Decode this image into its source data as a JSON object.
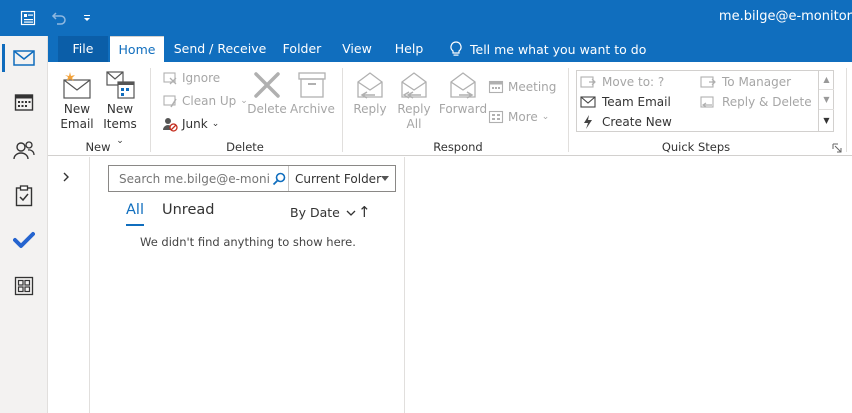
{
  "account": "me.bilge@e-monitor",
  "tabs": {
    "file": "File",
    "home": "Home",
    "send_receive": "Send / Receive",
    "folder": "Folder",
    "view": "View",
    "help": "Help",
    "tell_me": "Tell me what you want to do"
  },
  "ribbon": {
    "new": {
      "new_email": [
        "New",
        "Email"
      ],
      "new_items": [
        "New",
        "Items"
      ],
      "label": "New"
    },
    "delete": {
      "ignore": "Ignore",
      "clean_up": "Clean Up",
      "junk": "Junk",
      "delete": "Delete",
      "archive": "Archive",
      "label": "Delete"
    },
    "respond": {
      "reply": "Reply",
      "reply_all": [
        "Reply",
        "All"
      ],
      "forward": "Forward",
      "meeting": "Meeting",
      "more": "More",
      "label": "Respond"
    },
    "quick_steps": {
      "move_to": "Move to: ?",
      "team_email": "Team Email",
      "create_new": "Create New",
      "to_manager": "To Manager",
      "reply_delete": "Reply & Delete",
      "label": "Quick Steps"
    }
  },
  "message_list": {
    "search_placeholder": "Search me.bilge@e-monitor",
    "scope": "Current Folder",
    "filter_all": "All",
    "filter_unread": "Unread",
    "sort_by": "By Date",
    "sort_direction": "↑",
    "empty_text": "We didn't find anything to show here."
  },
  "colors": {
    "accent": "#106ebe",
    "disabled": "#a6a6a6"
  }
}
